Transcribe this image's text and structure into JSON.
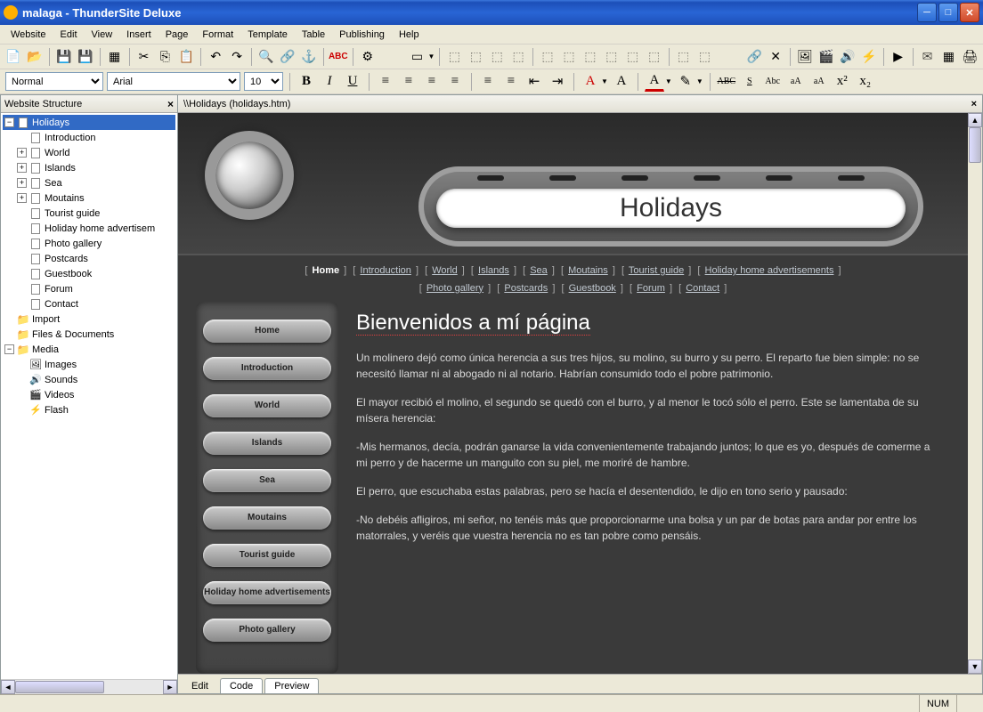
{
  "titlebar": {
    "title": "malaga - ThunderSite Deluxe"
  },
  "menubar": [
    "Website",
    "Edit",
    "View",
    "Insert",
    "Page",
    "Format",
    "Template",
    "Table",
    "Publishing",
    "Help"
  ],
  "format": {
    "style": "Normal",
    "font": "Arial",
    "size": "10"
  },
  "tree": {
    "header": "Website Structure",
    "root": "Holidays",
    "pages": [
      "Introduction",
      "World",
      "Islands",
      "Sea",
      "Moutains",
      "Tourist guide",
      "Holiday home advertisem",
      "Photo gallery",
      "Postcards",
      "Guestbook",
      "Forum",
      "Contact"
    ],
    "expandable": [
      "World",
      "Islands",
      "Sea",
      "Moutains"
    ],
    "import": "Import",
    "files": "Files & Documents",
    "media": "Media",
    "media_items": [
      "Images",
      "Sounds",
      "Videos",
      "Flash"
    ]
  },
  "editor": {
    "path": "\\\\Holidays (holidays.htm)",
    "tabs": [
      "Edit",
      "Code",
      "Preview"
    ],
    "active_tab": 0
  },
  "site": {
    "title": "Holidays",
    "nav_home": "Home",
    "nav": [
      "Introduction",
      "World",
      "Islands",
      "Sea",
      "Moutains",
      "Tourist guide",
      "Holiday home advertisements"
    ],
    "nav2": [
      "Photo gallery",
      "Postcards",
      "Guestbook",
      "Forum",
      "Contact"
    ],
    "side_nav": [
      "Home",
      "Introduction",
      "World",
      "Islands",
      "Sea",
      "Moutains",
      "Tourist guide",
      "Holiday home advertisements",
      "Photo gallery"
    ],
    "heading": "Bienvenidos a mí página",
    "p1": "Un molinero dejó como única herencia a sus tres hijos, su molino, su burro y su perro. El reparto fue bien simple: no se necesitó llamar ni al abogado ni al notario. Habrían consumido todo el pobre patrimonio.",
    "p2": "El mayor recibió el molino, el segundo se quedó con el burro, y al menor le tocó sólo el perro. Este se lamentaba de su mísera herencia:",
    "p3": "-Mis hermanos, decía, podrán ganarse la vida convenientemente trabajando juntos; lo que es yo, después de comerme a mi perro y de hacerme un manguito con su piel, me moriré de hambre.",
    "p4": "El perro, que escuchaba estas palabras, pero se hacía el desentendido, le dijo en tono serio y pausado:",
    "p5": "-No debéis afligiros, mi señor, no tenéis más que proporcionarme una bolsa y un par de botas para andar por entre los matorrales, y veréis que vuestra herencia no es tan pobre como pensáis."
  },
  "statusbar": {
    "num": "NUM"
  }
}
